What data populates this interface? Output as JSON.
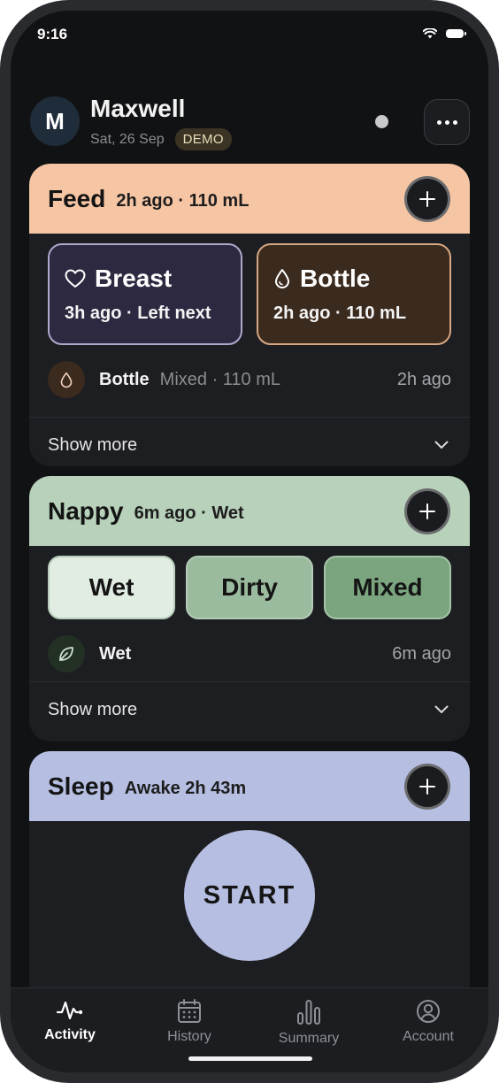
{
  "status_bar": {
    "time": "9:16"
  },
  "header": {
    "avatar_initial": "M",
    "name": "Maxwell",
    "date": "Sat, 26 Sep",
    "badge": "DEMO"
  },
  "feed": {
    "title": "Feed",
    "summary": "2h ago · 110 mL",
    "color": "#f5c5a4",
    "breast": {
      "label": "Breast",
      "sub": "3h ago · Left next",
      "icon": "heart-icon"
    },
    "bottle": {
      "label": "Bottle",
      "sub": "2h ago · 110 mL",
      "icon": "drop-icon"
    },
    "last_entry": {
      "name": "Bottle",
      "detail": "Mixed · 110 mL",
      "time": "2h ago",
      "icon": "drop-icon"
    },
    "show_more": "Show more"
  },
  "nappy": {
    "title": "Nappy",
    "summary": "6m ago · Wet",
    "color": "#b7d1ba",
    "options": [
      "Wet",
      "Dirty",
      "Mixed"
    ],
    "last_entry": {
      "name": "Wet",
      "time": "6m ago",
      "icon": "leaf-icon"
    },
    "show_more": "Show more"
  },
  "sleep": {
    "title": "Sleep",
    "summary": "Awake 2h 43m",
    "color": "#b6bfe2",
    "start_label": "START"
  },
  "nav": {
    "items": [
      {
        "label": "Activity",
        "icon": "activity-icon",
        "active": true
      },
      {
        "label": "History",
        "icon": "calendar-icon",
        "active": false
      },
      {
        "label": "Summary",
        "icon": "bar-chart-icon",
        "active": false
      },
      {
        "label": "Account",
        "icon": "account-icon",
        "active": false
      }
    ]
  }
}
